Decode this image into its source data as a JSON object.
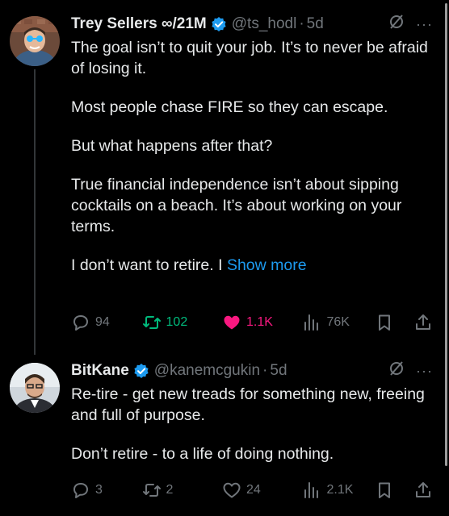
{
  "tweets": [
    {
      "display_name": "Trey Sellers ∞/21M",
      "handle": "@ts_hodl",
      "separator": "·",
      "time": "5d",
      "more": "···",
      "body": [
        "The goal isn’t to quit your job. It’s to never be afraid of losing it.",
        "Most people chase FIRE so they can escape.",
        "But what happens after that?",
        "True financial independence isn’t about sipping cocktails on a beach. It’s about working on your terms."
      ],
      "truncated_line": "I don’t want to retire. I ",
      "show_more": "Show more",
      "replies": "94",
      "reposts": "102",
      "likes": "1.1K",
      "views": "76K",
      "liked": true,
      "reposted": true
    },
    {
      "display_name": "BitKane",
      "handle": "@kanemcgukin",
      "separator": "·",
      "time": "5d",
      "more": "···",
      "body": [
        "Re-tire - get new treads for something new, freeing and full of purpose.",
        "Don’t retire - to a life of doing nothing."
      ],
      "replies": "3",
      "reposts": "2",
      "likes": "24",
      "views": "2.1K",
      "liked": false,
      "reposted": false
    }
  ],
  "colors": {
    "background": "#000000",
    "text": "#e7e9ea",
    "muted": "#71767b",
    "link": "#1d9bf0",
    "repost": "#00ba7c",
    "like": "#f91880",
    "verified": "#1d9bf0"
  },
  "icons": [
    "verified-badge-icon",
    "grok-icon",
    "more-icon",
    "reply-icon",
    "repost-icon",
    "like-icon",
    "views-icon",
    "bookmark-icon",
    "share-icon"
  ]
}
